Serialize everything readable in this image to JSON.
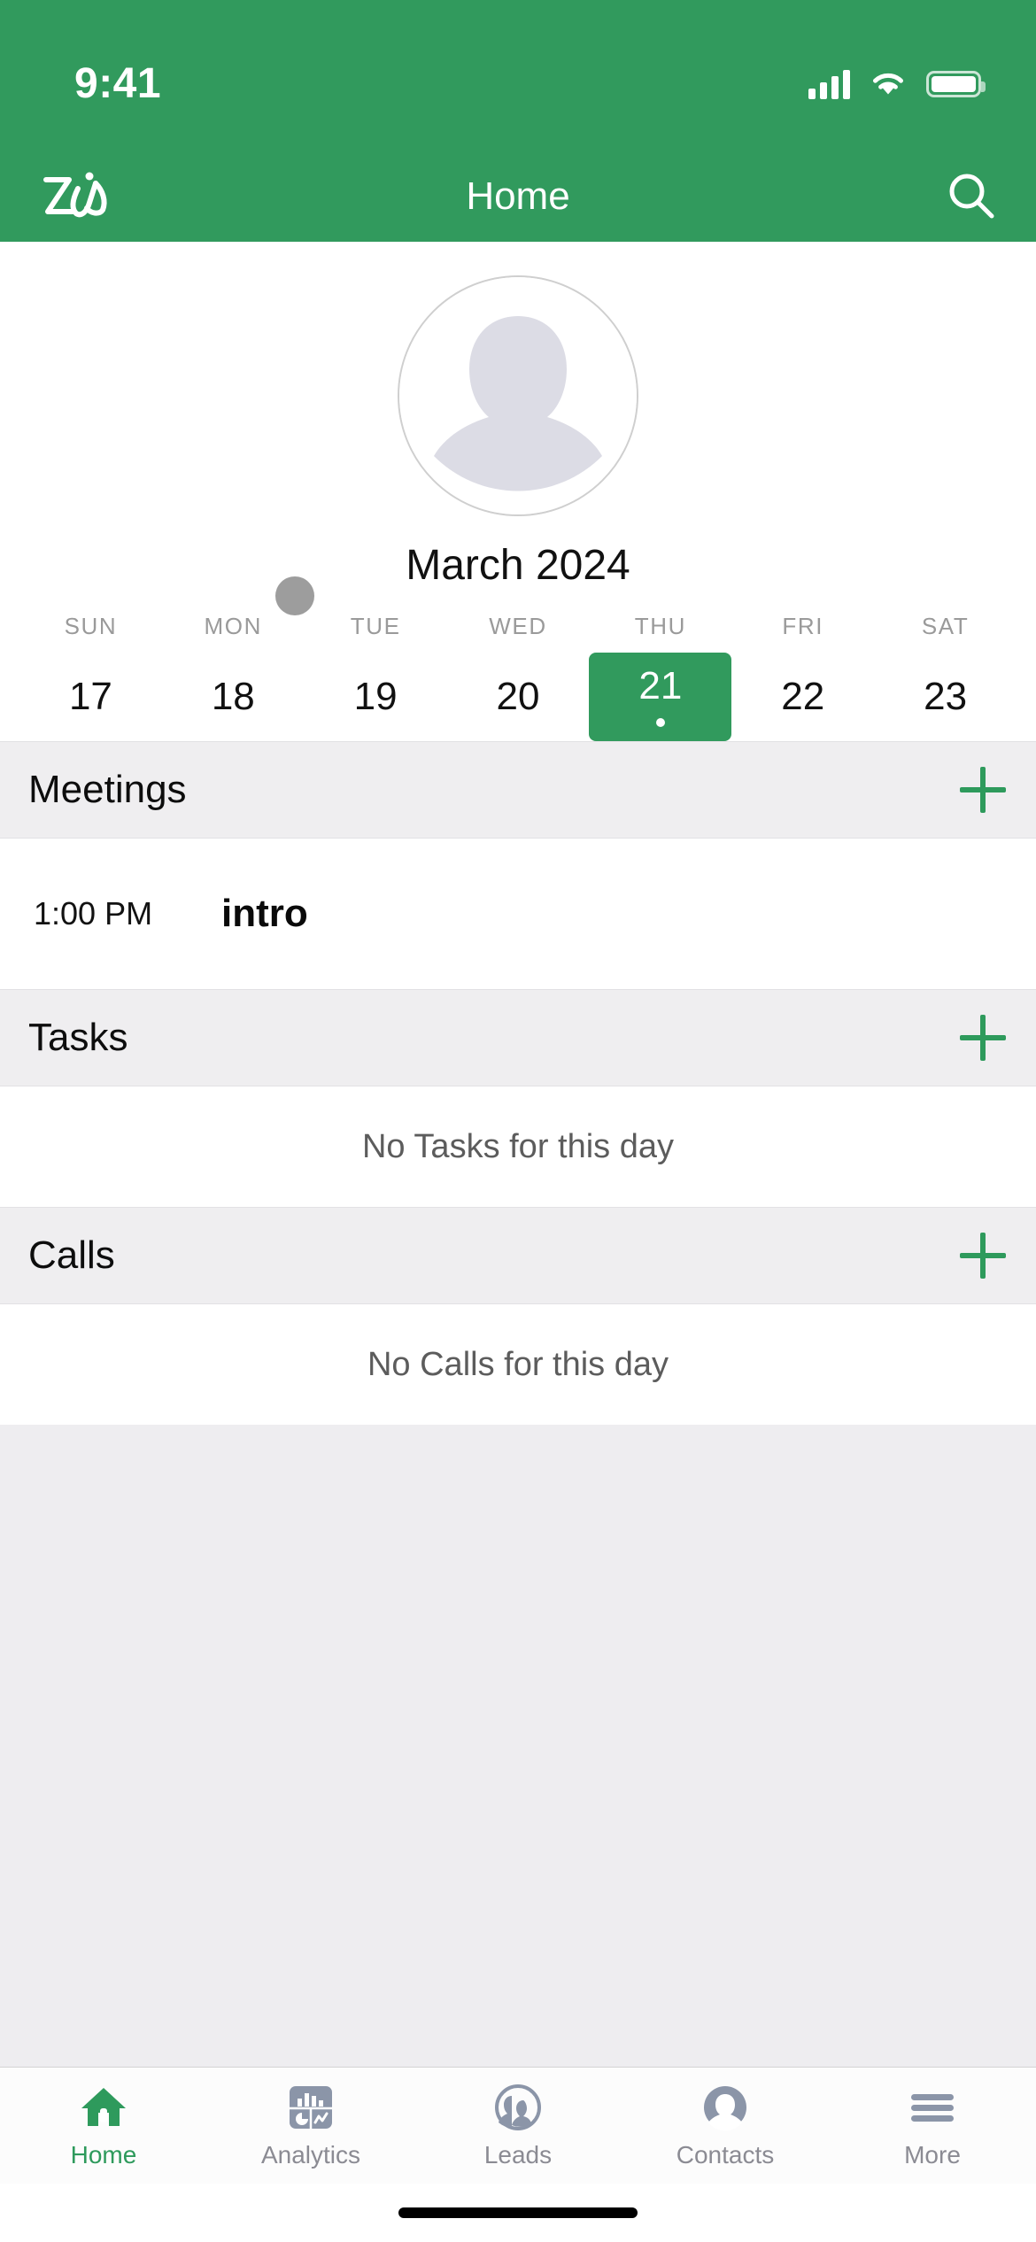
{
  "status_bar": {
    "time": "9:41",
    "signal_icon": "cellular-bars-icon",
    "wifi_icon": "wifi-icon",
    "battery_icon": "battery-icon"
  },
  "nav_bar": {
    "logo_name": "zia-logo",
    "title": "Home",
    "search_icon": "search-icon"
  },
  "profile": {
    "avatar_name": "user-avatar-placeholder"
  },
  "calendar": {
    "month_label": "March 2024",
    "drag_handle_name": "calendar-drag-handle",
    "weekdays": [
      "SUN",
      "MON",
      "TUE",
      "WED",
      "THU",
      "FRI",
      "SAT"
    ],
    "dates": [
      {
        "day": "17",
        "selected": false,
        "has_event": false
      },
      {
        "day": "18",
        "selected": false,
        "has_event": false
      },
      {
        "day": "19",
        "selected": false,
        "has_event": false
      },
      {
        "day": "20",
        "selected": false,
        "has_event": false
      },
      {
        "day": "21",
        "selected": true,
        "has_event": true
      },
      {
        "day": "22",
        "selected": false,
        "has_event": false
      },
      {
        "day": "23",
        "selected": false,
        "has_event": false
      }
    ]
  },
  "sections": {
    "meetings": {
      "title": "Meetings",
      "add_icon": "plus-icon",
      "items": [
        {
          "time": "1:00 PM",
          "title": "intro"
        }
      ]
    },
    "tasks": {
      "title": "Tasks",
      "add_icon": "plus-icon",
      "empty_text": "No Tasks for this day"
    },
    "calls": {
      "title": "Calls",
      "add_icon": "plus-icon",
      "empty_text": "No Calls for this day"
    }
  },
  "tab_bar": {
    "items": [
      {
        "label": "Home",
        "icon": "home-icon",
        "active": true
      },
      {
        "label": "Analytics",
        "icon": "analytics-icon",
        "active": false
      },
      {
        "label": "Leads",
        "icon": "leads-icon",
        "active": false
      },
      {
        "label": "Contacts",
        "icon": "contacts-icon",
        "active": false
      },
      {
        "label": "More",
        "icon": "hamburger-icon",
        "active": false
      }
    ]
  },
  "colors": {
    "brand_green": "#319A5D",
    "accent_green": "#2E9A5C",
    "section_gray": "#EFEEF0",
    "page_gray": "#EEEDF0",
    "muted_text": "#8b8b93"
  }
}
